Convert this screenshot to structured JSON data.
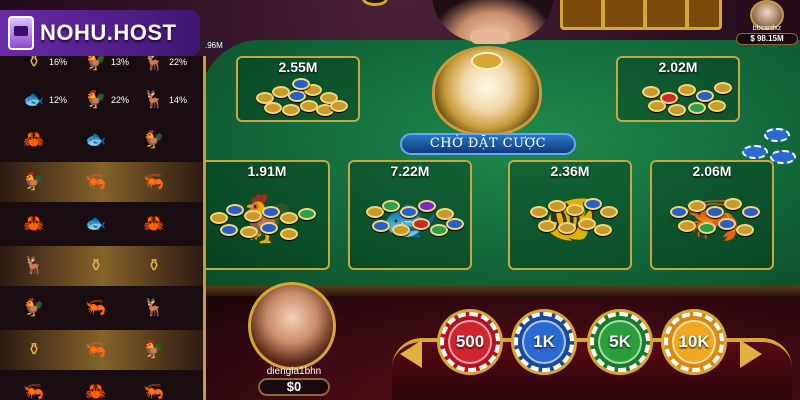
{
  "brand": {
    "name": "NOHU.HOST"
  },
  "side_balance": ".96M",
  "opponent": {
    "name": "bbcardxz",
    "balance": "$ 98.15M"
  },
  "status_text": "CHỜ ĐẶT CƯỢC",
  "history": {
    "rows": [
      {
        "highlight": false,
        "cells": [
          {
            "icon": "gourd-icon",
            "glyph": "⚱",
            "pct": "16%"
          },
          {
            "icon": "rooster-icon",
            "glyph": "🐓",
            "pct": "13%"
          },
          {
            "icon": "deer-icon",
            "glyph": "🦌",
            "pct": "22%"
          }
        ]
      },
      {
        "highlight": false,
        "cells": [
          {
            "icon": "fish-icon",
            "glyph": "🐟",
            "pct": "12%"
          },
          {
            "icon": "rooster-icon",
            "glyph": "🐓",
            "pct": "22%"
          },
          {
            "icon": "deer-icon",
            "glyph": "🦌",
            "pct": "14%"
          }
        ]
      },
      {
        "highlight": false,
        "cells": [
          {
            "icon": "crab-icon",
            "glyph": "🦀",
            "pct": ""
          },
          {
            "icon": "fish-icon",
            "glyph": "🐟",
            "pct": ""
          },
          {
            "icon": "rooster-icon",
            "glyph": "🐓",
            "pct": ""
          }
        ]
      },
      {
        "highlight": true,
        "cells": [
          {
            "icon": "rooster-icon",
            "glyph": "🐓",
            "pct": ""
          },
          {
            "icon": "shrimp-icon",
            "glyph": "🦐",
            "pct": ""
          },
          {
            "icon": "shrimp-icon",
            "glyph": "🦐",
            "pct": ""
          }
        ]
      },
      {
        "highlight": false,
        "cells": [
          {
            "icon": "crab-icon",
            "glyph": "🦀",
            "pct": ""
          },
          {
            "icon": "fish-icon",
            "glyph": "🐟",
            "pct": ""
          },
          {
            "icon": "crab-icon",
            "glyph": "🦀",
            "pct": ""
          }
        ]
      },
      {
        "highlight": true,
        "cells": [
          {
            "icon": "deer-icon",
            "glyph": "🦌",
            "pct": ""
          },
          {
            "icon": "gourd-icon",
            "glyph": "⚱",
            "pct": ""
          },
          {
            "icon": "gourd-icon",
            "glyph": "⚱",
            "pct": ""
          }
        ]
      },
      {
        "highlight": false,
        "cells": [
          {
            "icon": "rooster-icon",
            "glyph": "🐓",
            "pct": ""
          },
          {
            "icon": "shrimp-icon",
            "glyph": "🦐",
            "pct": ""
          },
          {
            "icon": "deer-icon",
            "glyph": "🦌",
            "pct": ""
          }
        ]
      },
      {
        "highlight": true,
        "cells": [
          {
            "icon": "gourd-icon",
            "glyph": "⚱",
            "pct": ""
          },
          {
            "icon": "shrimp-icon",
            "glyph": "🦐",
            "pct": ""
          },
          {
            "icon": "rooster-icon",
            "glyph": "🐓",
            "pct": ""
          }
        ]
      },
      {
        "highlight": false,
        "cells": [
          {
            "icon": "shrimp-icon",
            "glyph": "🦐",
            "pct": ""
          },
          {
            "icon": "crab-icon",
            "glyph": "🦀",
            "pct": ""
          },
          {
            "icon": "shrimp-icon",
            "glyph": "🦐",
            "pct": ""
          }
        ]
      }
    ]
  },
  "bet_zones": [
    {
      "id": "gourd",
      "amount": "2.55M",
      "icon": "gourd-icon"
    },
    {
      "id": "crab",
      "amount": "2.02M",
      "icon": "crab-icon"
    },
    {
      "id": "rooster",
      "amount": "1.91M",
      "icon": "rooster-icon"
    },
    {
      "id": "fish",
      "amount": "7.22M",
      "icon": "fish-icon"
    },
    {
      "id": "carp",
      "amount": "2.36M",
      "icon": "carp-icon"
    },
    {
      "id": "shrimp",
      "amount": "2.06M",
      "icon": "shrimp-icon"
    }
  ],
  "player": {
    "name": "diengia1bhn",
    "balance": "$0"
  },
  "chips": [
    {
      "label": "500"
    },
    {
      "label": "1K"
    },
    {
      "label": "5K"
    },
    {
      "label": "10K"
    }
  ]
}
